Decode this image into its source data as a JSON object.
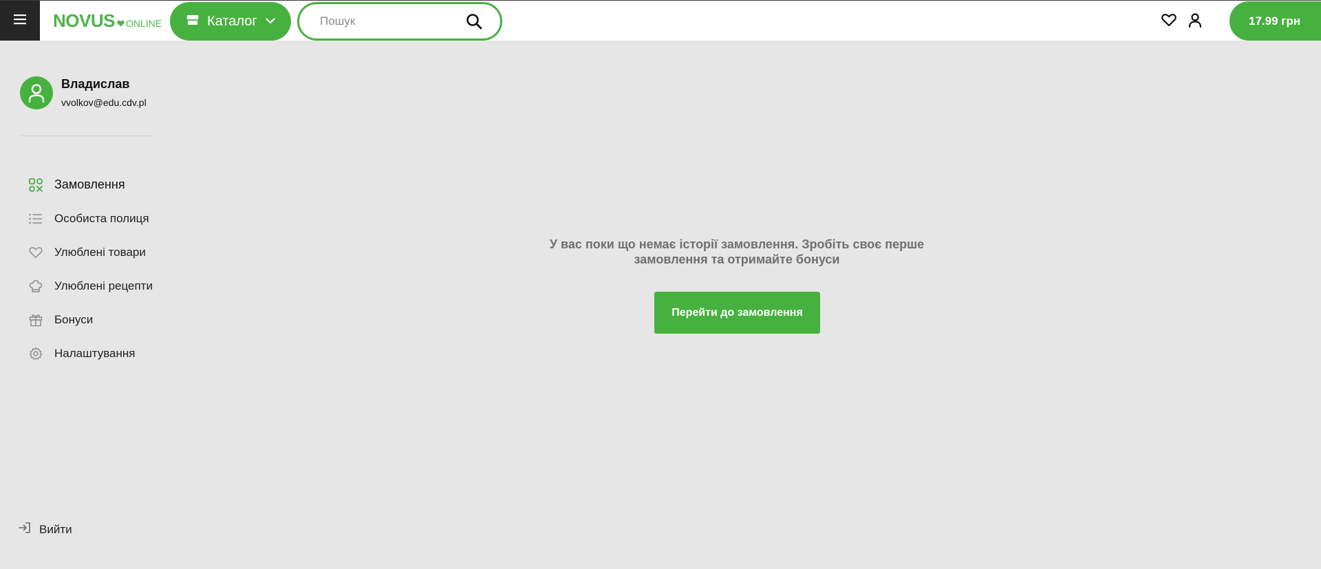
{
  "brand": {
    "logo_main": "NOVUS",
    "logo_sub": "ONLINE",
    "accent_color": "#47b140"
  },
  "header": {
    "catalog_label": "Каталог",
    "search_placeholder": "Пошук",
    "cart_total": "17.99 грн",
    "icons": [
      "menu-icon",
      "store-icon",
      "chevron-down-icon",
      "search-icon",
      "heart-icon",
      "user-icon"
    ]
  },
  "profile": {
    "name": "Владислав",
    "email": "vvolkov@edu.cdv.pl"
  },
  "sidebar": {
    "items": [
      {
        "label": "Замовлення",
        "icon": "orders-icon",
        "active": true
      },
      {
        "label": "Особиста полиця",
        "icon": "list-icon",
        "active": false
      },
      {
        "label": "Улюблені товари",
        "icon": "heart-icon",
        "active": false
      },
      {
        "label": "Улюблені рецепти",
        "icon": "chef-hat-icon",
        "active": false
      },
      {
        "label": "Бонуси",
        "icon": "gift-icon",
        "active": false
      },
      {
        "label": "Налаштування",
        "icon": "gear-icon",
        "active": false
      }
    ],
    "logout_label": "Вийти"
  },
  "main": {
    "empty_message": "У вас поки що немає історії замовлення. Зробіть своє перше замовлення та отримайте бонуси",
    "cta_label": "Перейти до замовлення"
  }
}
